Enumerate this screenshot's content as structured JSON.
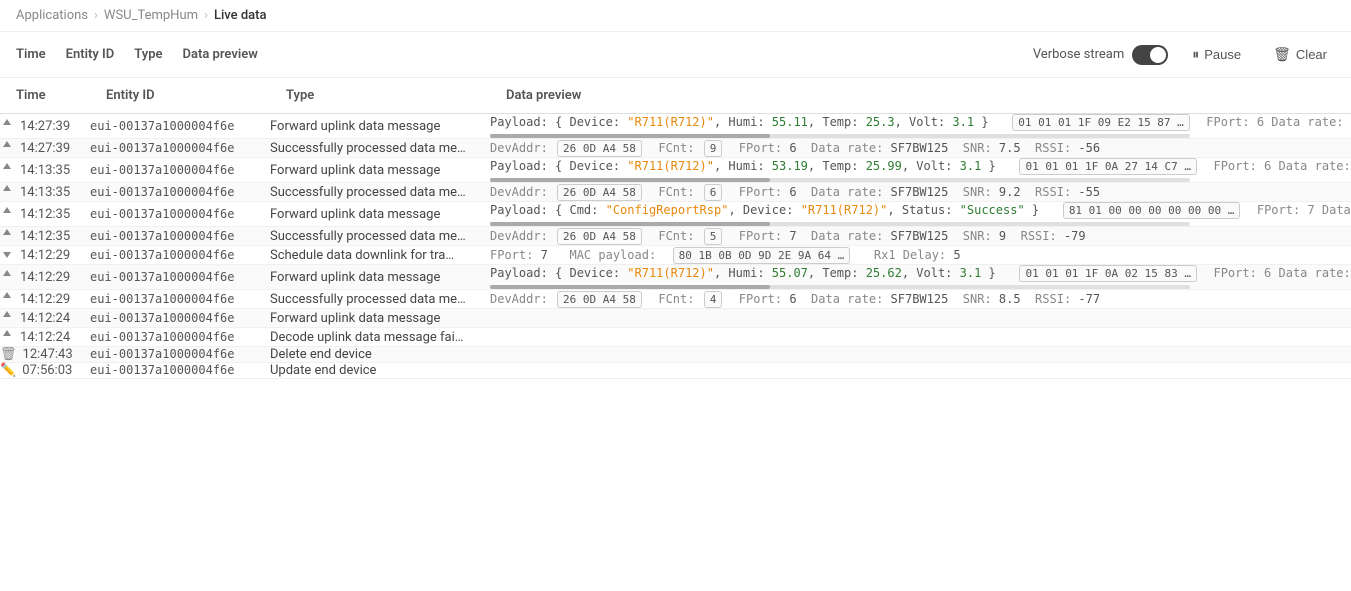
{
  "breadcrumb": {
    "items": [
      "Applications",
      "WSU_TempHum",
      "Live data"
    ],
    "separators": [
      ">",
      ">"
    ]
  },
  "toolbar": {
    "verbose_label": "Verbose stream",
    "pause_label": "Pause",
    "clear_label": "Clear",
    "toggle_on": true
  },
  "table": {
    "headers": [
      "Time",
      "Entity ID",
      "Type",
      "Data preview"
    ],
    "rows": [
      {
        "id": "r1",
        "direction": "up",
        "time": "14:27:39",
        "entity_id": "eui-00137a1000004f6e",
        "type": "Forward uplink data message",
        "preview_type": "payload",
        "preview_html": "Payload: { Device: \"R711(R712)\", Humi: 55.11, Temp: 25.3, Volt: 3.1 }",
        "preview_extra": "01 01 01 1F 09 E2 15 87 …",
        "preview_extra2": "FPort: 6  Data rate:",
        "has_scrollbar": true,
        "group": "a"
      },
      {
        "id": "r2",
        "direction": "up",
        "time": "14:27:39",
        "entity_id": "eui-00137a1000004f6e",
        "type": "Successfully processed data me…",
        "preview_type": "fields",
        "devaddr": "26 0D A4 58",
        "fcnt": "9",
        "fport": "6",
        "datarate": "SF7BW125",
        "snr": "7.5",
        "rssi": "-56",
        "has_scrollbar": false,
        "group": "a"
      },
      {
        "id": "r3",
        "direction": "up",
        "time": "14:13:35",
        "entity_id": "eui-00137a1000004f6e",
        "type": "Forward uplink data message",
        "preview_type": "payload",
        "preview_html": "Payload: { Device: \"R711(R712)\", Humi: 53.19, Temp: 25.99, Volt: 3.1 }",
        "preview_extra": "01 01 01 1F 0A 27 14 C7 …",
        "preview_extra2": "FPort: 6  Data rate:",
        "has_scrollbar": true,
        "group": "b"
      },
      {
        "id": "r4",
        "direction": "up",
        "time": "14:13:35",
        "entity_id": "eui-00137a1000004f6e",
        "type": "Successfully processed data me…",
        "preview_type": "fields",
        "devaddr": "26 0D A4 58",
        "fcnt": "6",
        "fport": "6",
        "datarate": "SF7BW125",
        "snr": "9.2",
        "rssi": "-55",
        "has_scrollbar": false,
        "group": "b"
      },
      {
        "id": "r5",
        "direction": "up",
        "time": "14:12:35",
        "entity_id": "eui-00137a1000004f6e",
        "type": "Forward uplink data message",
        "preview_type": "payload_cmd",
        "preview_html": "Payload: { Cmd: \"ConfigReportRsp\", Device: \"R711(R712)\", Status: \"Success\" }",
        "preview_extra": "81 01 00 00 00 00 00 00 …",
        "preview_extra2": "FPort: 7  Data",
        "has_scrollbar": true,
        "group": "c"
      },
      {
        "id": "r6",
        "direction": "up",
        "time": "14:12:35",
        "entity_id": "eui-00137a1000004f6e",
        "type": "Successfully processed data me…",
        "preview_type": "fields",
        "devaddr": "26 0D A4 58",
        "fcnt": "5",
        "fport": "7",
        "datarate": "SF7BW125",
        "snr": "9",
        "rssi": "-79",
        "has_scrollbar": false,
        "group": "c"
      },
      {
        "id": "r7",
        "direction": "down",
        "time": "14:12:29",
        "entity_id": "eui-00137a1000004f6e",
        "type": "Schedule data downlink for tra…",
        "preview_type": "downlink",
        "fport": "7",
        "mac_payload": "80 1B 0B 0D 9D 2E 9A 64 …",
        "rx1_delay": "5",
        "has_scrollbar": false,
        "group": "d"
      },
      {
        "id": "r8",
        "direction": "up",
        "time": "14:12:29",
        "entity_id": "eui-00137a1000004f6e",
        "type": "Forward uplink data message",
        "preview_type": "payload",
        "preview_html": "Payload: { Device: \"R711(R712)\", Humi: 55.07, Temp: 25.62, Volt: 3.1 }",
        "preview_extra": "01 01 01 1F 0A 02 15 83 …",
        "preview_extra2": "FPort: 6  Data rate:",
        "has_scrollbar": true,
        "group": "d"
      },
      {
        "id": "r9",
        "direction": "up",
        "time": "14:12:29",
        "entity_id": "eui-00137a1000004f6e",
        "type": "Successfully processed data me…",
        "preview_type": "fields",
        "devaddr": "26 0D A4 58",
        "fcnt": "4",
        "fport": "6",
        "datarate": "SF7BW125",
        "snr": "8.5",
        "rssi": "-77",
        "has_scrollbar": false,
        "group": "d"
      },
      {
        "id": "r10",
        "direction": "up",
        "time": "14:12:24",
        "entity_id": "eui-00137a1000004f6e",
        "type": "Forward uplink data message",
        "preview_type": "none",
        "has_scrollbar": false,
        "group": "e"
      },
      {
        "id": "r11",
        "direction": "up",
        "time": "14:12:24",
        "entity_id": "eui-00137a1000004f6e",
        "type": "Decode uplink data message fai…",
        "preview_type": "none",
        "has_scrollbar": false,
        "group": "e"
      },
      {
        "id": "r12",
        "direction": "trash",
        "time": "12:47:43",
        "entity_id": "eui-00137a1000004f6e",
        "type": "Delete end device",
        "preview_type": "none",
        "has_scrollbar": false,
        "group": "f"
      },
      {
        "id": "r13",
        "direction": "edit",
        "time": "07:56:03",
        "entity_id": "eui-00137a1000004f6e",
        "type": "Update end device",
        "preview_type": "none",
        "has_scrollbar": false,
        "group": "g"
      }
    ]
  }
}
